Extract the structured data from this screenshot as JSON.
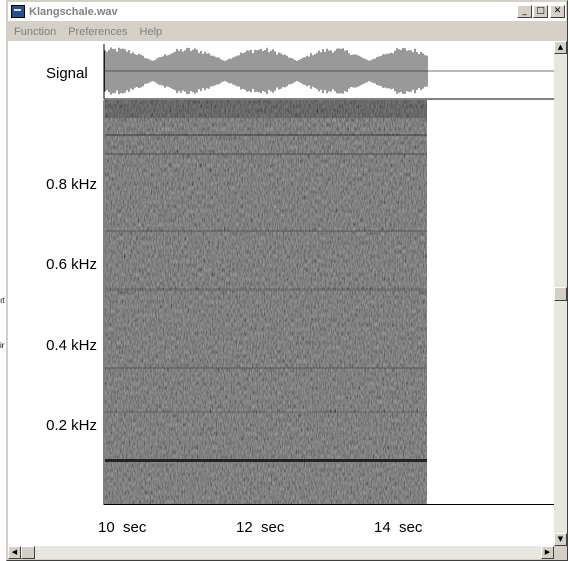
{
  "window": {
    "title": "Klangschale.wav",
    "minimize_label": "_",
    "maximize_label": "□",
    "close_label": "✕"
  },
  "menu": {
    "items": [
      "Function",
      "Preferences",
      "Help"
    ]
  },
  "left_fragments": [
    "ıt",
    "ir"
  ],
  "plot": {
    "signal_label": "Signal",
    "frequency_labels": [
      "0.8 kHz",
      "0.6 kHz",
      "0.4 kHz",
      "0.2 kHz"
    ],
    "time_labels": [
      "10  sec",
      "12  sec",
      "14  sec"
    ]
  },
  "scrollbars": {
    "up_arrow": "▲",
    "down_arrow": "▼",
    "left_arrow": "◀",
    "right_arrow": "▶",
    "vertical_position": 0.5,
    "horizontal_position": 0.0
  },
  "colors": {
    "spectrogram_base": "#5a5a5a",
    "waveform": "#333333",
    "tone_band": "#1a1a1a"
  }
}
